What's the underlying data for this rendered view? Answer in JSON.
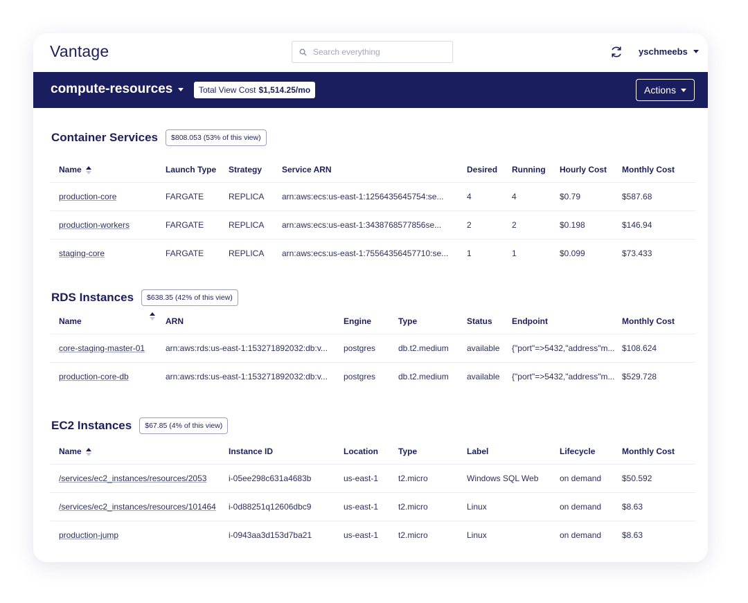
{
  "header": {
    "logo": "Vantage",
    "search_placeholder": "Search everything",
    "user": "yschmeebs"
  },
  "bar": {
    "view": "compute-resources",
    "total_label": "Total View Cost",
    "total_value": "$1,514.25/mo",
    "actions": "Actions"
  },
  "sections": [
    {
      "key": "container",
      "title": "Container Services",
      "badge": "$808.053 (53% of this view)",
      "columns": [
        "Name",
        "Launch Type",
        "Strategy",
        "Service ARN",
        "Desired",
        "Running",
        "Hourly Cost",
        "Monthly Cost"
      ],
      "rows": [
        [
          "production-core",
          "FARGATE",
          "REPLICA",
          "arn:aws:ecs:us-east-1:1256435645754:se...",
          "4",
          "4",
          "$0.79",
          "$587.68"
        ],
        [
          "production-workers",
          "FARGATE",
          "REPLICA",
          "arn:aws:ecs:us-east-1:3438768577856se...",
          "2",
          "2",
          "$0.198",
          "$146.94"
        ],
        [
          "staging-core",
          "FARGATE",
          "REPLICA",
          "arn:aws:ecs:us-east-1:75564356457710:se...",
          "1",
          "1",
          "$0.099",
          "$73.433"
        ]
      ]
    },
    {
      "key": "rds",
      "title": "RDS Instances",
      "badge": "$638.35 (42% of this view)",
      "columns": [
        "Name",
        "ARN",
        "Engine",
        "Type",
        "Status",
        "Endpoint",
        "Monthly Cost"
      ],
      "rows": [
        [
          "core-staging-master-01",
          "arn:aws:rds:us-east-1:153271892032:db:v...",
          "postgres",
          "db.t2.medium",
          "available",
          "{\"port\"=>5432,\"address\"m...",
          "$108.624"
        ],
        [
          "production-core-db",
          "arn:aws:rds:us-east-1:153271892032:db:v...",
          "postgres",
          "db.t2.medium",
          "available",
          "{\"port\"=>5432,\"address\"m...",
          "$529.728"
        ]
      ]
    },
    {
      "key": "ec2",
      "title": "EC2 Instances",
      "badge": "$67.85 (4% of this view)",
      "columns": [
        "Name",
        "Instance ID",
        "Location",
        "Type",
        "Label",
        "Lifecycle",
        "Monthly Cost"
      ],
      "rows": [
        [
          "/services/ec2_instances/resources/2053",
          "i-05ee298c631a4683b",
          "us-east-1",
          "t2.micro",
          "Windows SQL Web",
          "on demand",
          "$50.592"
        ],
        [
          "/services/ec2_instances/resources/101464",
          "i-0d88251q12606dbc9",
          "us-east-1",
          "t2.micro",
          "Linux",
          "on demand",
          "$8.63"
        ],
        [
          "production-jump",
          "i-0943aa3d153d7ba21",
          "us-east-1",
          "t2.micro",
          "Linux",
          "on demand",
          "$8.63"
        ]
      ]
    }
  ]
}
